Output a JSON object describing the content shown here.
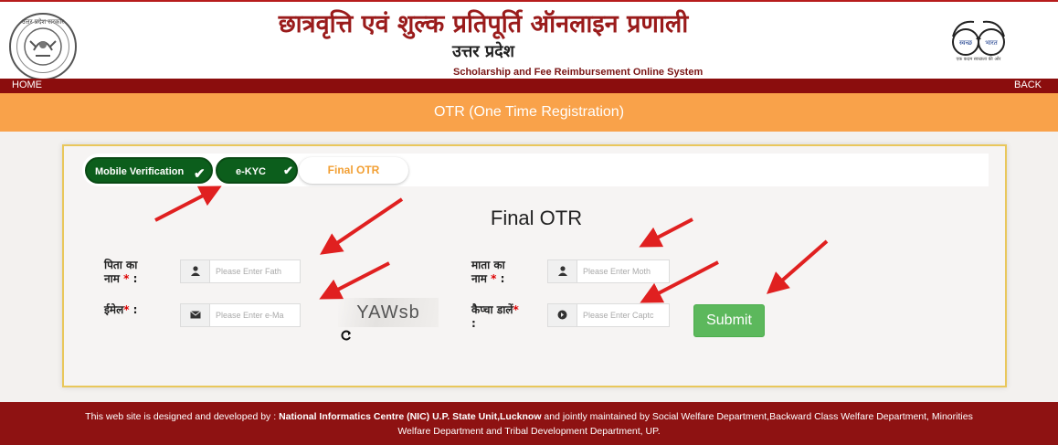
{
  "header": {
    "emblem_text": "उत्तर प्रदेश सरकार",
    "title_hi": "छात्रवृत्ति एवं शुल्क प्रतिपूर्ति ऑनलाइन प्रणाली",
    "state_hi": "उत्तर प्रदेश",
    "title_en": "Scholarship and Fee Reimbursement Online System",
    "swachh_label_left": "स्वच्छ",
    "swachh_label_right": "भारत",
    "swachh_tagline": "एक कदम स्वच्छता की ओर"
  },
  "nav": {
    "home": "HOME",
    "back": "BACK"
  },
  "banner": {
    "title": "OTR (One Time Registration)"
  },
  "steps": [
    {
      "label": "Mobile Verification",
      "state": "done"
    },
    {
      "label": "e-KYC",
      "state": "done"
    },
    {
      "label": "Final OTR",
      "state": "current"
    }
  ],
  "form": {
    "title": "Final OTR",
    "father": {
      "label_line1": "पिता का",
      "label_line2": "नाम",
      "req": "*",
      "colon": " :",
      "placeholder": "Please Enter Fath",
      "icon": "user-icon"
    },
    "mother": {
      "label_line1": "माता का",
      "label_line2": "नाम",
      "req": "*",
      "colon": " :",
      "placeholder": "Please Enter Moth",
      "icon": "user-icon"
    },
    "email": {
      "label": "ईमेल",
      "req": "*",
      "colon": " :",
      "placeholder": "Please Enter e-Ma",
      "icon": "envelope-icon"
    },
    "captcha_input": {
      "label": "कैप्चा डालें",
      "req": "*",
      "colon": ":",
      "placeholder": "Please Enter Captc",
      "icon": "arrow-circle-icon"
    },
    "captcha_text": "YAWsb",
    "submit_label": "Submit"
  },
  "footer": {
    "prefix": "This web site is designed and developed by : ",
    "nic": "National Informatics Centre (NIC) U.P. State Unit,Lucknow",
    "suffix": " and jointly maintained by Social Welfare Department,Backward Class Welfare Department, Minorities Welfare Department and Tribal Development Department, UP."
  },
  "colors": {
    "header_red": "#9a1b1b",
    "nav_bar": "#8b0d0d",
    "banner_orange": "#f9a24a",
    "step_done_green": "#0c5e1c",
    "step_current_orange": "#f29f33",
    "submit_green": "#5cb85c",
    "annotation_arrow_red": "#e02020",
    "footer_red": "#8e1212"
  }
}
